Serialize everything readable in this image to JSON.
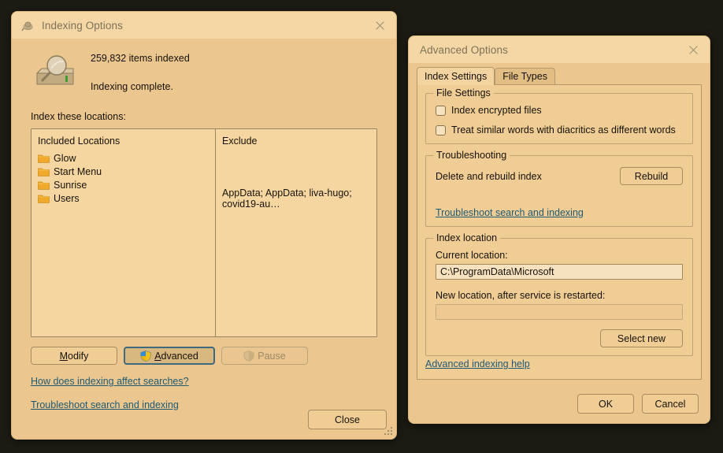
{
  "indexing_window": {
    "title": "Indexing Options",
    "icon": "indexing-options-icon",
    "close_icon": "close-icon",
    "status": {
      "icon": "drive-search-icon",
      "items_indexed": "259,832 items indexed",
      "state": "Indexing complete."
    },
    "locations_label": "Index these locations:",
    "table": {
      "columns": [
        "Included Locations",
        "Exclude"
      ],
      "rows": [
        {
          "name": "Glow",
          "exclude": ""
        },
        {
          "name": "Start Menu",
          "exclude": ""
        },
        {
          "name": "Sunrise",
          "exclude": ""
        },
        {
          "name": "Users",
          "exclude": "AppData; AppData; liva-hugo; covid19-au…"
        }
      ]
    },
    "buttons": {
      "modify": "Modify",
      "modify_accel": "M",
      "advanced": "Advanced",
      "advanced_accel": "A",
      "pause": "Pause",
      "close": "Close"
    },
    "links": {
      "how_does_indexing": "How does indexing affect searches?",
      "troubleshoot": "Troubleshoot search and indexing"
    }
  },
  "advanced_window": {
    "title": "Advanced Options",
    "close_icon": "close-icon",
    "tabs": [
      {
        "label": "Index Settings",
        "active": true
      },
      {
        "label": "File Types",
        "active": false
      }
    ],
    "file_settings": {
      "title": "File Settings",
      "checkboxes": [
        {
          "label": "Index encrypted files",
          "checked": false
        },
        {
          "label": "Treat similar words with diacritics as different words",
          "checked": false
        }
      ]
    },
    "troubleshooting": {
      "title": "Troubleshooting",
      "delete_rebuild_label": "Delete and rebuild index",
      "rebuild_button": "Rebuild",
      "link": "Troubleshoot search and indexing"
    },
    "index_location": {
      "title": "Index location",
      "current_label": "Current location:",
      "current_value": "C:\\ProgramData\\Microsoft",
      "new_label": "New location, after service is restarted:",
      "new_value": "",
      "select_new_button": "Select new"
    },
    "help_link": "Advanced indexing help",
    "footer": {
      "ok": "OK",
      "cancel": "Cancel"
    }
  },
  "colors": {
    "desktop_bg": "#1b1a13",
    "window_bg": "#ebc78f",
    "titlebar_bg": "#f4d7a5",
    "field_bg": "#f7e2bf",
    "link": "#1f5a74",
    "focus_border": "#3f6a7d",
    "folder_icon": "#f0a92a"
  }
}
